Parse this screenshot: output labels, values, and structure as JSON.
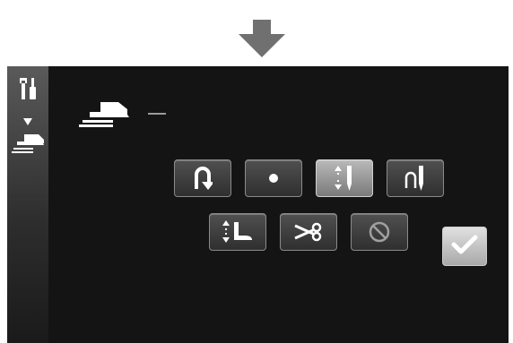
{
  "header_indicator": {
    "icon": "down-arrow-icon",
    "color": "#707070"
  },
  "sidebar": {
    "icons": [
      "tools-icon",
      "chevron-down-small-icon",
      "foot-pedal-icon"
    ]
  },
  "pedal_label_icon": "foot-pedal-icon",
  "functions": [
    {
      "id": "reverse-stitch",
      "icon": "u-turn-arrow-icon",
      "selected": false
    },
    {
      "id": "single-stitch",
      "icon": "dot-icon",
      "selected": false
    },
    {
      "id": "needle-up-down",
      "icon": "needle-up-down-icon",
      "selected": true
    },
    {
      "id": "needle-position",
      "icon": "needle-position-icon",
      "selected": false
    },
    {
      "id": "presser-foot-lift",
      "icon": "presser-foot-up-down-icon",
      "selected": false
    },
    {
      "id": "thread-cut",
      "icon": "scissors-icon",
      "selected": false
    },
    {
      "id": "no-function",
      "icon": "prohibited-icon",
      "selected": false
    }
  ],
  "confirm": {
    "icon": "checkmark-icon"
  },
  "colors": {
    "screen_bg": "#141414",
    "button_bg": "#3a3a3a",
    "button_selected_bg": "#9a9a9a",
    "icon_white": "#ffffff"
  }
}
